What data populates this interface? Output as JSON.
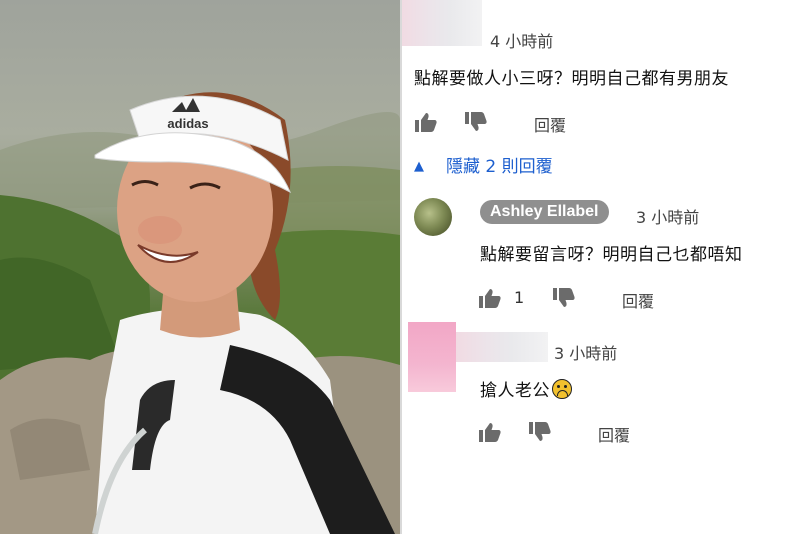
{
  "comments": [
    {
      "time": "4 小時前",
      "text": "點解要做人小三呀？明明自己都有男朋友",
      "like_count": "",
      "reply_label": "回覆"
    },
    {
      "author": "Ashley Ellabel",
      "time": "3 小時前",
      "text": "點解要留言呀？明明自己乜都唔知",
      "like_count": "1",
      "reply_label": "回覆"
    },
    {
      "time": "3 小時前",
      "text": "搶人老公",
      "emoji": "frowning-face",
      "like_count": "",
      "reply_label": "回覆"
    }
  ],
  "hide_replies_label": "隱藏 2 則回覆",
  "photo": {
    "subject": "smiling woman in white visor on mountain hike",
    "visor_brand": "adidas"
  },
  "colors": {
    "link_blue": "#1d5fcf",
    "name_chip_gray": "#8f8f8f",
    "blur_pink": "#f2a7c6"
  },
  "icons": [
    "thumbs-up-icon",
    "thumbs-down-icon",
    "caret-up-icon",
    "frowning-face-emoji"
  ]
}
